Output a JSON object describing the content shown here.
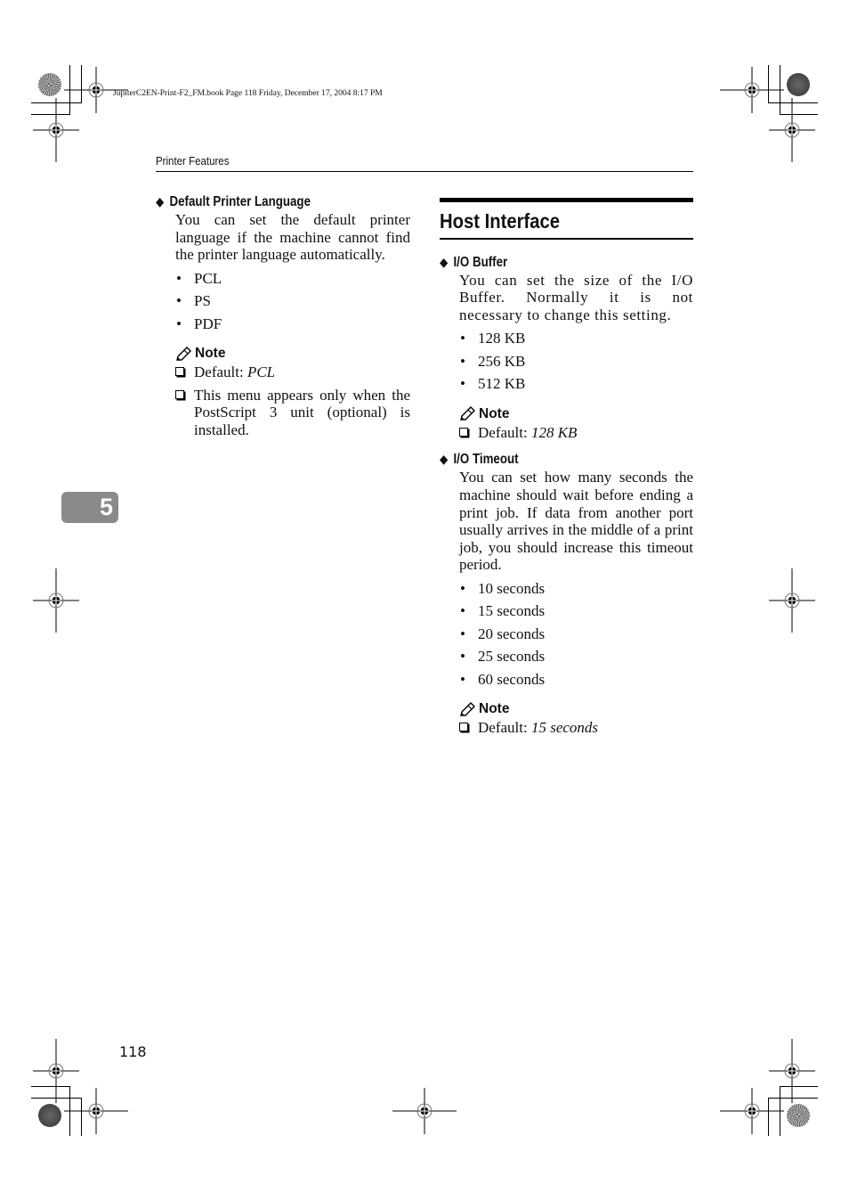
{
  "book_info": "JupiterC2EN-Print-F2_FM.book  Page 118  Friday, December 17, 2004  8:17 PM",
  "running_head": "Printer Features",
  "chapter_tab": "5",
  "page_number": "118",
  "left_column": {
    "subhead": "Default Printer Language",
    "description": "You can set the default printer language if the machine cannot find the printer language automatically.",
    "options": [
      "PCL",
      "PS",
      "PDF"
    ],
    "note_label": "Note",
    "notes": [
      {
        "prefix": "Default: ",
        "value": "PCL"
      },
      {
        "prefix": "This menu appears only when the PostScript 3 unit (optional) is installed.",
        "value": ""
      }
    ]
  },
  "right_column": {
    "section_title": "Host Interface",
    "io_buffer": {
      "subhead": "I/O Buffer",
      "description": "You can set the size of the I/O Buffer. Normally it is not necessary to change this setting.",
      "options": [
        "128 KB",
        "256 KB",
        "512 KB"
      ],
      "note_label": "Note",
      "notes": [
        {
          "prefix": "Default: ",
          "value": "128 KB"
        }
      ]
    },
    "io_timeout": {
      "subhead": "I/O Timeout",
      "description": "You can set how many seconds the machine should wait before ending a print job. If data from another port usually arrives in the middle of a print job, you should increase this timeout period.",
      "options": [
        "10 seconds",
        "15 seconds",
        "20 seconds",
        "25 seconds",
        "60 seconds"
      ],
      "note_label": "Note",
      "notes": [
        {
          "prefix": "Default: ",
          "value": "15 seconds"
        }
      ]
    }
  },
  "icons": {
    "subhead_marker": "◆",
    "bullet": "•",
    "note_icon": "pencil-icon",
    "note_item_marker": "checkbox-icon"
  },
  "colors": {
    "chapter_tab_bg": "#8a8a8a",
    "text": "#111111"
  }
}
